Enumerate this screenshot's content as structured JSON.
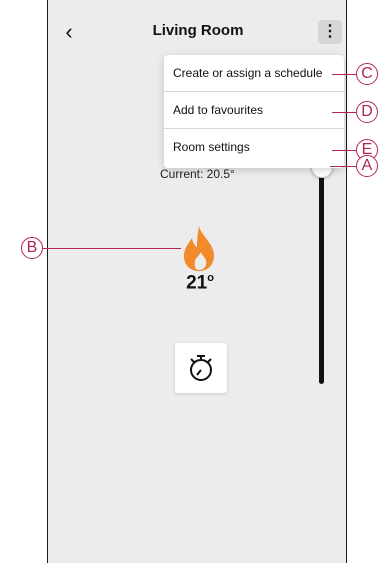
{
  "header": {
    "back_icon": "chevron-left-icon",
    "title": "Living Room",
    "menu_icon": "more-vertical-icon"
  },
  "menu": {
    "items": [
      {
        "label": "Create or assign a schedule"
      },
      {
        "label": "Add to favourites"
      },
      {
        "label": "Room settings"
      }
    ]
  },
  "status": {
    "current_text": "Current: 20.5°"
  },
  "setpoint": {
    "value": "21",
    "unit": "o"
  },
  "slider": {
    "level": 0.79
  },
  "icons": {
    "heating": "flame-icon",
    "timer": "stopwatch-icon"
  },
  "callouts": {
    "a": "A",
    "b": "B",
    "c": "C",
    "d": "D",
    "e": "E"
  },
  "colors": {
    "flame": "#f28a2c",
    "callout": "#b3264f",
    "background": "#ececec"
  }
}
